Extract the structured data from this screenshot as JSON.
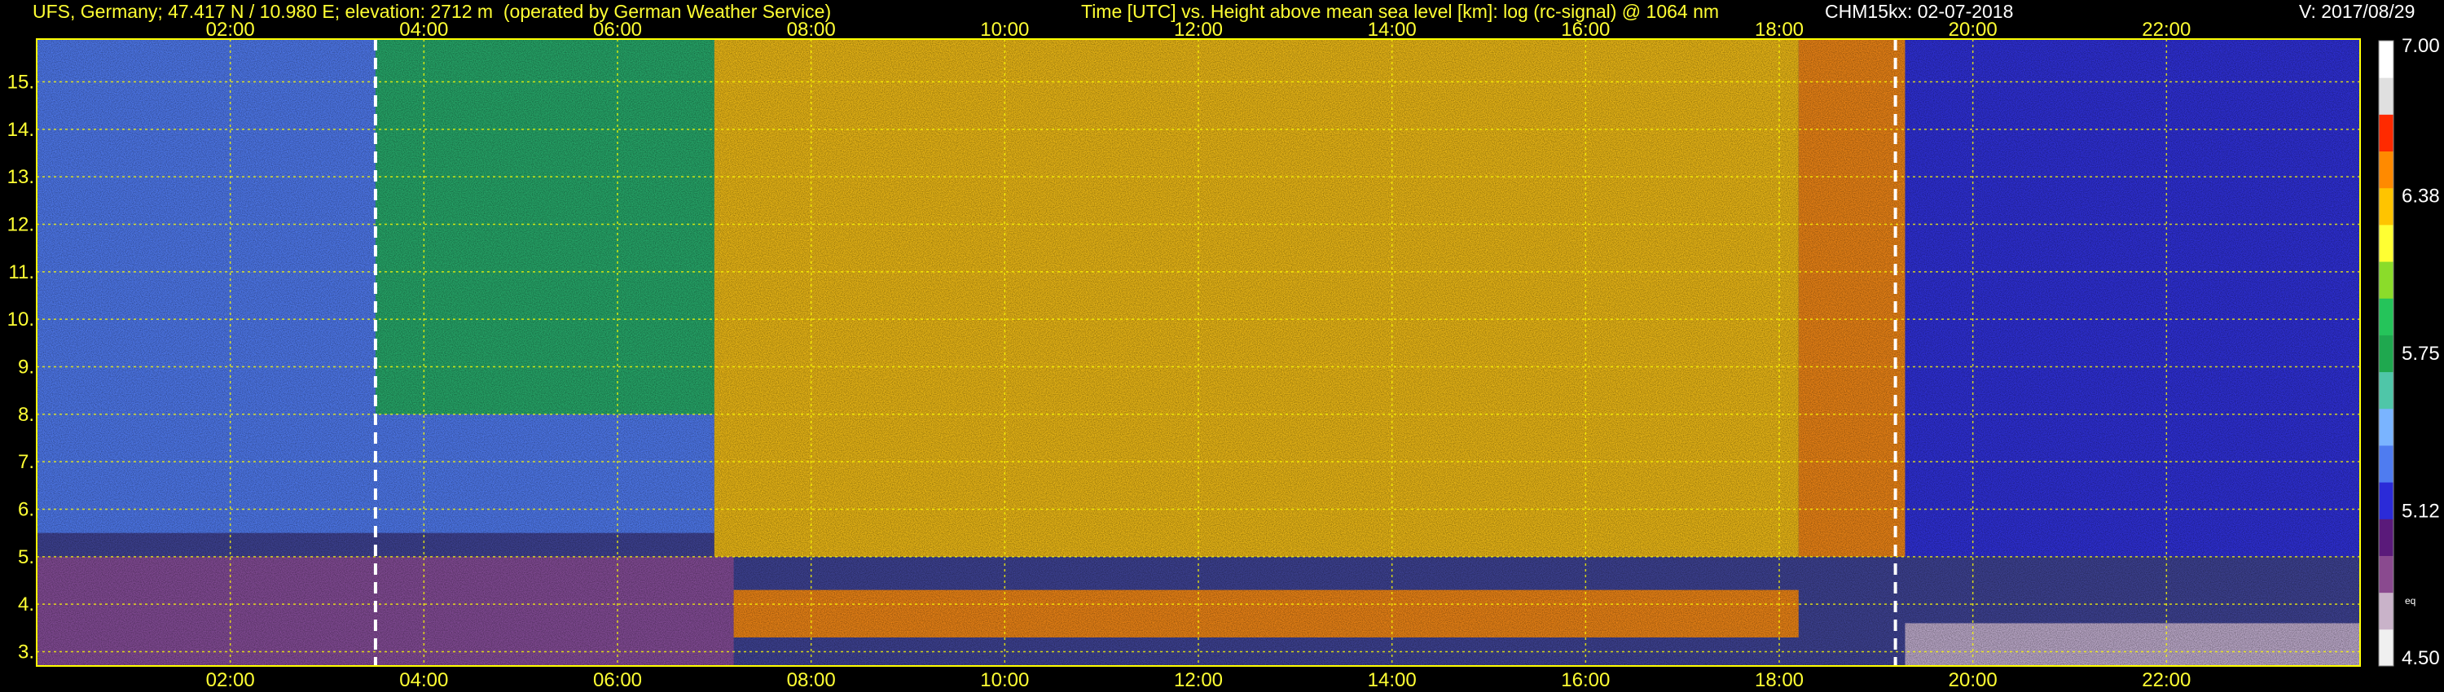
{
  "header": {
    "station": "UFS, Germany; 47.417 N / 10.980 E; elevation: 2712 m  (operated by German Weather Service)",
    "plot_desc": "Time [UTC] vs. Height above mean sea level [km]: log (rc-signal) @ 1064 nm",
    "instrument_date": "CHM15kx: 02-07-2018",
    "version": "V: 2017/08/29",
    "station_color": "#ffff33",
    "desc_color": "#ffff33",
    "instrument_color": "#ffffff",
    "version_color": "#ffffff"
  },
  "chart_data": {
    "type": "heatmap",
    "title": "Time [UTC] vs. Height above mean sea level [km]: log (rc-signal) @ 1064 nm",
    "xlim": [
      0,
      24
    ],
    "ylim": [
      2.7,
      15.9
    ],
    "x_ticks": [
      2,
      4,
      6,
      8,
      10,
      12,
      14,
      16,
      18,
      20,
      22
    ],
    "x_tick_labels": [
      "02:00",
      "04:00",
      "06:00",
      "08:00",
      "10:00",
      "12:00",
      "14:00",
      "16:00",
      "18:00",
      "20:00",
      "22:00"
    ],
    "y_ticks": [
      3,
      4,
      5,
      6,
      7,
      8,
      9,
      10,
      11,
      12,
      13,
      14,
      15
    ],
    "y_tick_labels": [
      "3.",
      "4.",
      "5.",
      "6.",
      "7.",
      "8.",
      "9.",
      "10.",
      "11.",
      "12.",
      "13.",
      "14.",
      "15."
    ],
    "grid": true,
    "grid_color": "#ffff00",
    "dashed_markers": [
      3.5,
      19.2
    ],
    "colorbar": {
      "min": 4.5,
      "max": 7.0,
      "tick_values": [
        4.5,
        5.12,
        5.75,
        6.38,
        7.0
      ],
      "tick_labels": [
        "4.50",
        "5.12",
        "5.75",
        "6.38",
        "7.00"
      ],
      "extra_label": "eq",
      "colors": [
        "#f0f0f0",
        "#c9b3c9",
        "#8a4a8f",
        "#5a1a7a",
        "#2b2bd8",
        "#4f7cf0",
        "#7ab4ff",
        "#4fc6a8",
        "#1fa84f",
        "#25c45a",
        "#8bdc2a",
        "#ffff33",
        "#ffc400",
        "#ff8a00",
        "#ff2a00",
        "#e0e0e0",
        "#ffffff"
      ]
    },
    "regions": [
      {
        "t0": 0.0,
        "t1": 7.0,
        "h0": 5.5,
        "h1": 15.9,
        "level": 5.3
      },
      {
        "t0": 3.5,
        "t1": 7.0,
        "h0": 8.0,
        "h1": 15.9,
        "level": 5.8
      },
      {
        "t0": 7.0,
        "t1": 18.2,
        "h0": 5.0,
        "h1": 15.9,
        "level": 6.4
      },
      {
        "t0": 18.2,
        "t1": 19.3,
        "h0": 5.0,
        "h1": 15.9,
        "level": 6.5
      },
      {
        "t0": 19.3,
        "t1": 24.0,
        "h0": 5.0,
        "h1": 15.9,
        "level": 5.2
      },
      {
        "t0": 0.0,
        "t1": 7.2,
        "h0": 2.7,
        "h1": 5.0,
        "level": 4.9
      },
      {
        "t0": 7.2,
        "t1": 18.2,
        "h0": 3.3,
        "h1": 4.3,
        "level": 6.5
      },
      {
        "t0": 19.3,
        "t1": 24.0,
        "h0": 2.7,
        "h1": 3.6,
        "level": 4.7
      }
    ]
  }
}
